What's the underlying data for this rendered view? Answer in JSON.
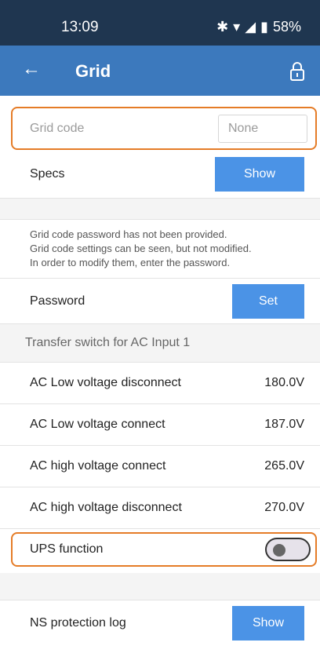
{
  "status_bar": {
    "time": "13:09",
    "battery": "58%"
  },
  "app_bar": {
    "title": "Grid"
  },
  "grid_code": {
    "label": "Grid code",
    "placeholder": "None"
  },
  "specs": {
    "label": "Specs",
    "button": "Show"
  },
  "password_info": {
    "lines": [
      "Grid code password has not been provided.",
      "Grid code settings can be seen, but not modified.",
      "In order to modify them, enter the password."
    ]
  },
  "password": {
    "label": "Password",
    "button": "Set"
  },
  "transfer_section": {
    "header": "Transfer switch for AC Input 1"
  },
  "settings": [
    {
      "label": "AC Low voltage disconnect",
      "value": "180.0V"
    },
    {
      "label": "AC Low voltage connect",
      "value": "187.0V"
    },
    {
      "label": "AC high voltage connect",
      "value": "265.0V"
    },
    {
      "label": "AC high voltage disconnect",
      "value": "270.0V"
    }
  ],
  "ups": {
    "label": "UPS function",
    "enabled": false
  },
  "ns_log": {
    "label": "NS protection log",
    "button": "Show"
  }
}
